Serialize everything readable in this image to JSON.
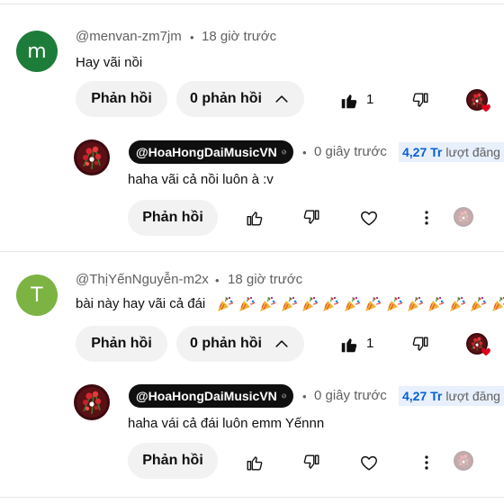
{
  "colors": {
    "accent": "#065fd4",
    "text": "#0f0f0f",
    "muted": "#606060",
    "pill_bg": "#f2f2f2",
    "avatar_m": "#1e7c3a",
    "avatar_t": "#7cb342"
  },
  "comments": [
    {
      "avatar_letter": "m",
      "username": "@menvan-zm7jm",
      "dot": "•",
      "time": "18 giờ trước",
      "text": "Hay vãi nồi",
      "reply_label": "Phản hồi",
      "replies_label": "0 phản hồi",
      "like_count": "1",
      "creator_reply": {
        "channel": "@HoaHongDaiMusicVN",
        "dot": "•",
        "time": "0 giây trước",
        "subscribers": "4,27 Tr",
        "subscribers_label": "lượt đăng k",
        "text": "haha vãi cả nồi luôn à :v",
        "reply_label": "Phản hồi"
      }
    },
    {
      "avatar_letter": "T",
      "username": "@ThịYếnNguyễn-m2x",
      "dot": "•",
      "time": "18 giờ trước",
      "text": "bài này hay vãi cả đái",
      "emoji_count": 14,
      "reply_label": "Phản hồi",
      "replies_label": "0 phản hồi",
      "like_count": "1",
      "creator_reply": {
        "channel": "@HoaHongDaiMusicVN",
        "dot": "•",
        "time": "0 giây trước",
        "subscribers": "4,27 Tr",
        "subscribers_label": "lượt đăng k",
        "text": "haha vái cả đái luôn emm Yếnnn",
        "reply_label": "Phản hồi"
      }
    }
  ]
}
